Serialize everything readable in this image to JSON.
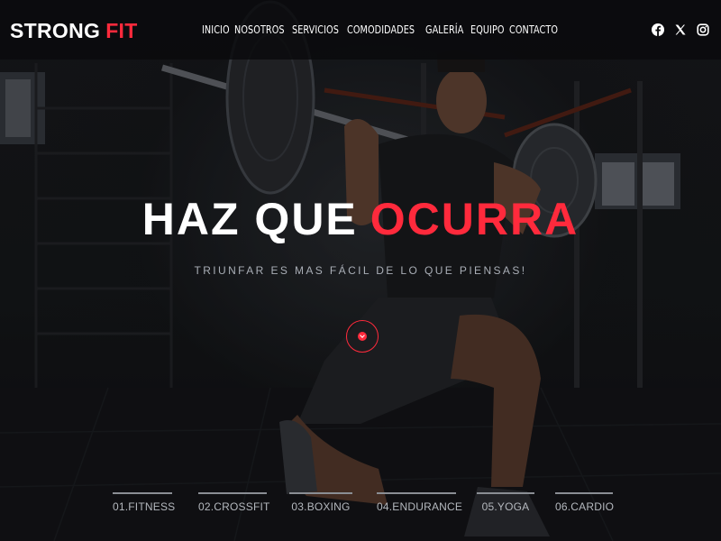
{
  "brand": {
    "part1": "STRONG",
    "part2": "FIT",
    "accent_color": "#ff2a3c"
  },
  "nav": {
    "items": [
      "INICIO",
      "NOSOTROS",
      "SERVICIOS",
      "COMODIDADES",
      "GALERÍA",
      "EQUIPO",
      "CONTACTO"
    ],
    "social_icons": [
      "facebook-icon",
      "x-icon",
      "instagram-icon"
    ]
  },
  "hero": {
    "headline_part1": "HAZ QUE",
    "headline_part2": "OCURRA",
    "subtitle": "TRIUNFAR ES MAS FÁCIL DE LO QUE PIENSAS!",
    "scroll_icon": "chevron-down-circle-icon",
    "background": "gym-athlete-with-barbell-lunge"
  },
  "categories": [
    "01.FITNESS",
    "02.CROSSFIT",
    "03.BOXING",
    "04.ENDURANCE",
    "05.YOGA",
    "06.CARDIO"
  ]
}
